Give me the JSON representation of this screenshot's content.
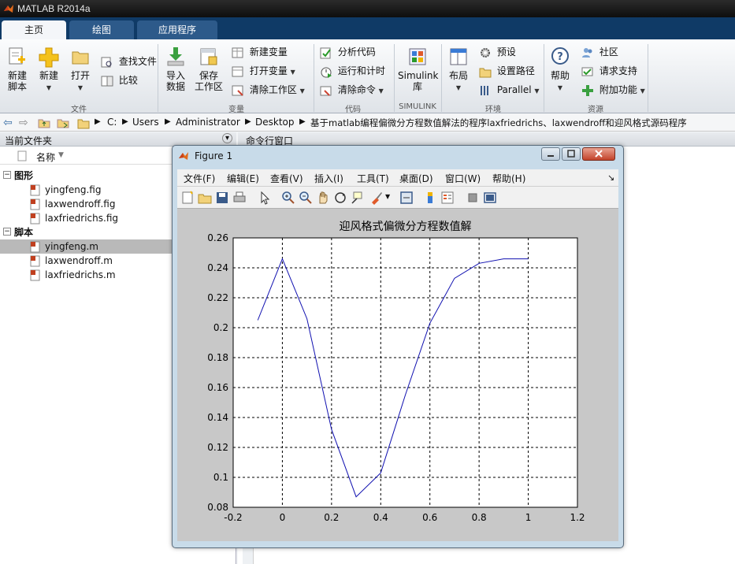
{
  "app": {
    "title": "MATLAB R2014a"
  },
  "tabs": [
    {
      "label": "主页"
    },
    {
      "label": "绘图"
    },
    {
      "label": "应用程序"
    }
  ],
  "ribbon": {
    "file": {
      "label": "文件",
      "new_script": [
        "新建",
        "脚本"
      ],
      "new": "新建",
      "open": "打开",
      "find_files": "查找文件",
      "compare": "比较"
    },
    "variable": {
      "label": "变量",
      "import_data": [
        "导入",
        "数据"
      ],
      "save_workspace": [
        "保存",
        "工作区"
      ],
      "new_variable": "新建变量",
      "open_variable": "打开变量",
      "clear_workspace": "清除工作区"
    },
    "code": {
      "label": "代码",
      "analyze_code": "分析代码",
      "run_and_time": "运行和计时",
      "clear_commands": "清除命令"
    },
    "simulink": {
      "label": "SIMULINK",
      "simulink_library": [
        "Simulink",
        "库"
      ]
    },
    "environment": {
      "label": "环境",
      "layout": "布局",
      "preferences": "预设",
      "set_path": "设置路径",
      "parallel": "Parallel"
    },
    "resources": {
      "label": "资源",
      "help": "帮助",
      "community": "社区",
      "request_support": "请求支持",
      "add_ons": "附加功能"
    }
  },
  "address": {
    "segments": [
      "C:",
      "Users",
      "Administrator",
      "Desktop",
      "基于matlab编程偏微分方程数值解法的程序laxfriedrichs、laxwendroff和迎风格式源码程序"
    ]
  },
  "file_panel": {
    "title": "当前文件夹",
    "column_name": "名称",
    "groups": [
      {
        "label": "图形",
        "files": [
          "yingfeng.fig",
          "laxwendroff.fig",
          "laxfriedrichs.fig"
        ]
      },
      {
        "label": "脚本",
        "files": [
          "yingfeng.m",
          "laxwendroff.m",
          "laxfriedrichs.m"
        ]
      }
    ]
  },
  "command_panel": {
    "title": "命令行窗口"
  },
  "figure": {
    "window_title": "Figure 1",
    "menus": [
      "文件(F)",
      "编辑(E)",
      "查看(V)",
      "插入(I)",
      "工具(T)",
      "桌面(D)",
      "窗口(W)",
      "帮助(H)"
    ],
    "colors": {
      "line": "#1010b0",
      "plot_bg": "#ffffff",
      "figure_bg": "#c8c8c8"
    }
  },
  "chart_data": {
    "type": "line",
    "title": "迎风格式偏微分方程数值解",
    "xlabel": "",
    "ylabel": "",
    "xlim": [
      -0.2,
      1.2
    ],
    "ylim": [
      0.08,
      0.26
    ],
    "xticks": [
      "-0.2",
      "0",
      "0.2",
      "0.4",
      "0.6",
      "0.8",
      "1",
      "1.2"
    ],
    "yticks": [
      "0.08",
      "0.1",
      "0.12",
      "0.14",
      "0.16",
      "0.18",
      "0.2",
      "0.22",
      "0.24",
      "0.26"
    ],
    "grid": true,
    "series": [
      {
        "x": [
          -0.1,
          0,
          0.1,
          0.2,
          0.3,
          0.4,
          0.5,
          0.6,
          0.7,
          0.8,
          0.9,
          1.0
        ],
        "y": [
          0.205,
          0.246,
          0.206,
          0.132,
          0.087,
          0.103,
          0.155,
          0.203,
          0.233,
          0.243,
          0.246,
          0.246
        ]
      }
    ]
  }
}
